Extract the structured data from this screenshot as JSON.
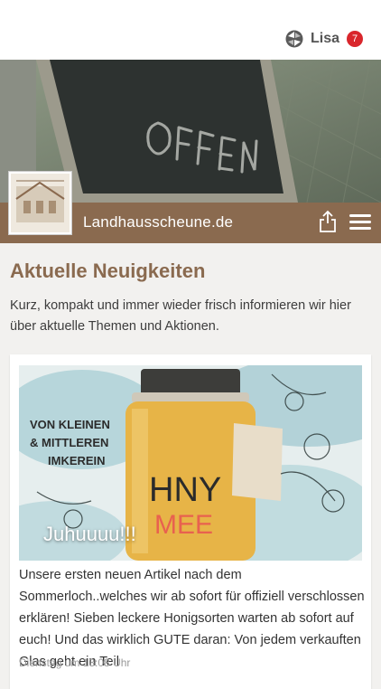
{
  "topbar": {
    "user_name": "Lisa",
    "notification_count": "7",
    "brand_icon": "app-logo-icon",
    "badge_color": "#d9262c"
  },
  "header": {
    "hero_sign_text": "OFFEN",
    "site_title": "Landhausscheune.de",
    "bar_color": "#8a6a4f",
    "share_icon": "share-icon",
    "menu_icon": "hamburger-menu-icon"
  },
  "news": {
    "title": "Aktuelle Neuigkeiten",
    "description": "Kurz, kompakt und immer wieder frisch informieren wir hier über aktuelle Themen und Aktionen.",
    "title_color": "#8a6a4f"
  },
  "post": {
    "image_caption": "Juhuuuu!!!",
    "image_headline_1": "VON KLEINEN",
    "image_headline_2": "& MITTLEREN",
    "image_headline_3": "IMKEREIN",
    "jar_label_1": "HNY",
    "jar_label_2": "MEE",
    "excerpt": "Unsere ersten neuen Artikel nach dem Sommerloch..welches wir ab sofort für offiziell verschlossen erklären! Sieben leckere Honigsorten warten ab sofort auf euch! Und das wirklich GUTE daran: Von jedem verkauften Glas geht ein Teil",
    "date": "Dienstag um 13:08 Uhr"
  }
}
